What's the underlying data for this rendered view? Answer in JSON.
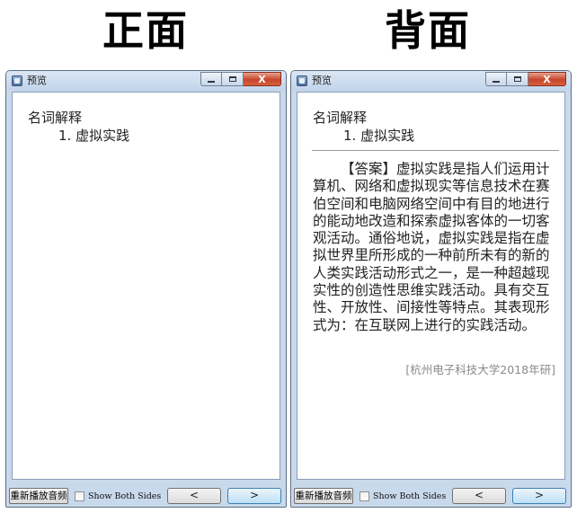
{
  "headings": {
    "front": "正面",
    "back": "背面"
  },
  "window": {
    "title": "预览",
    "controls": {
      "minimize": "minimize-icon",
      "maximize": "maximize-icon",
      "close_label": "X"
    }
  },
  "card": {
    "category": "名词解释",
    "item": "1. 虚拟实践",
    "answer": "【答案】虚拟实践是指人们运用计算机、网络和虚拟现实等信息技术在赛伯空间和电脑网络空间中有目的地进行的能动地改造和探索虚拟客体的一切客观活动。通俗地说，虚拟实践是指在虚拟世界里所形成的一种前所未有的新的人类实践活动形式之一，是一种超越现实性的创造性思维实践活动。具有交互性、开放性、间接性等特点。其表现形式为：在互联网上进行的实践活动。",
    "source": "[杭州电子科技大学2018年研]"
  },
  "footer": {
    "replay_label": "重新播放音频",
    "show_both_label": "Show Both Sides",
    "show_both_checked": false,
    "prev_label": "<",
    "next_label": ">"
  }
}
